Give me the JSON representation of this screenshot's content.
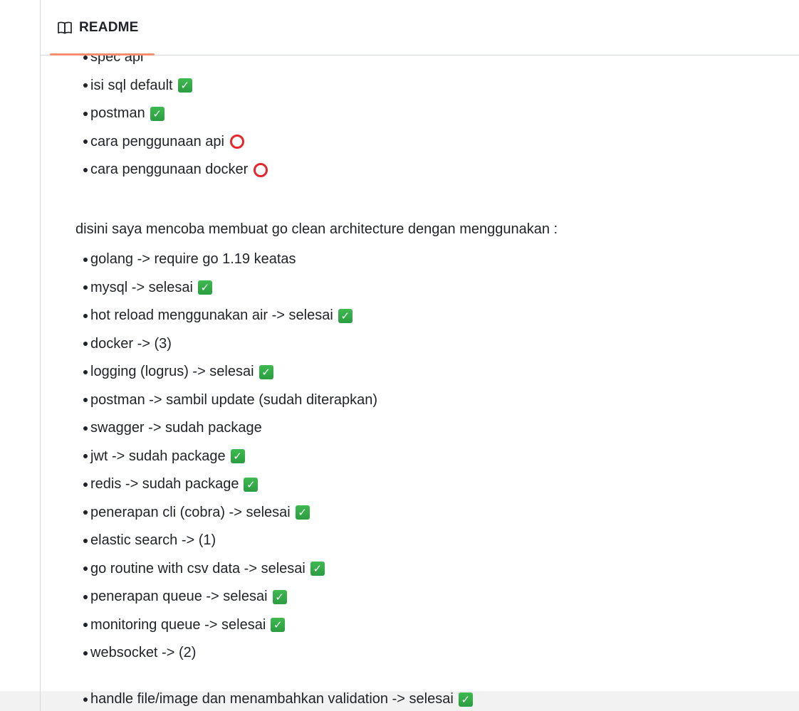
{
  "readme": {
    "tab_label": "README"
  },
  "list_top": [
    {
      "text": "spec api",
      "status": ""
    },
    {
      "text": "isi sql default",
      "status": "check"
    },
    {
      "text": "postman",
      "status": "check"
    },
    {
      "text": "cara penggunaan api",
      "status": "circle"
    },
    {
      "text": "cara penggunaan docker",
      "status": "circle"
    }
  ],
  "paragraph": "disini saya mencoba membuat go clean architecture dengan menggunakan :",
  "list_main": [
    {
      "text": "golang -> require go 1.19 keatas",
      "status": ""
    },
    {
      "text": "mysql -> selesai",
      "status": "check"
    },
    {
      "text": "hot reload menggunakan air -> selesai",
      "status": "check"
    },
    {
      "text": "docker -> (3)",
      "status": ""
    },
    {
      "text": "logging (logrus) -> selesai",
      "status": "check"
    },
    {
      "text": "postman -> sambil update (sudah diterapkan)",
      "status": ""
    },
    {
      "text": "swagger -> sudah package",
      "status": ""
    },
    {
      "text": "jwt -> sudah package",
      "status": "check"
    },
    {
      "text": "redis -> sudah package",
      "status": "check"
    },
    {
      "text": "penerapan cli (cobra) -> selesai",
      "status": "check"
    },
    {
      "text": "elastic search -> (1)",
      "status": ""
    },
    {
      "text": "go routine with csv data -> selesai",
      "status": "check"
    },
    {
      "text": "penerapan queue -> selesai",
      "status": "check"
    },
    {
      "text": "monitoring queue -> selesai",
      "status": "check"
    },
    {
      "text": "websocket -> (2)",
      "status": ""
    }
  ],
  "list_last": {
    "text": "handle file/image dan menambahkan validation -> selesai",
    "status": "check"
  },
  "icons": {
    "readme_tab": "book-icon",
    "check": "white-heavy-check-mark-icon",
    "circle": "red-hollow-circle-icon"
  },
  "colors": {
    "check_green": "#3fb950",
    "circle_red": "#e5262b",
    "tab_underline": "#fd8c73",
    "text": "#1f2328",
    "border": "#d0d7de",
    "bottom_bar": "#f2f2f2"
  }
}
